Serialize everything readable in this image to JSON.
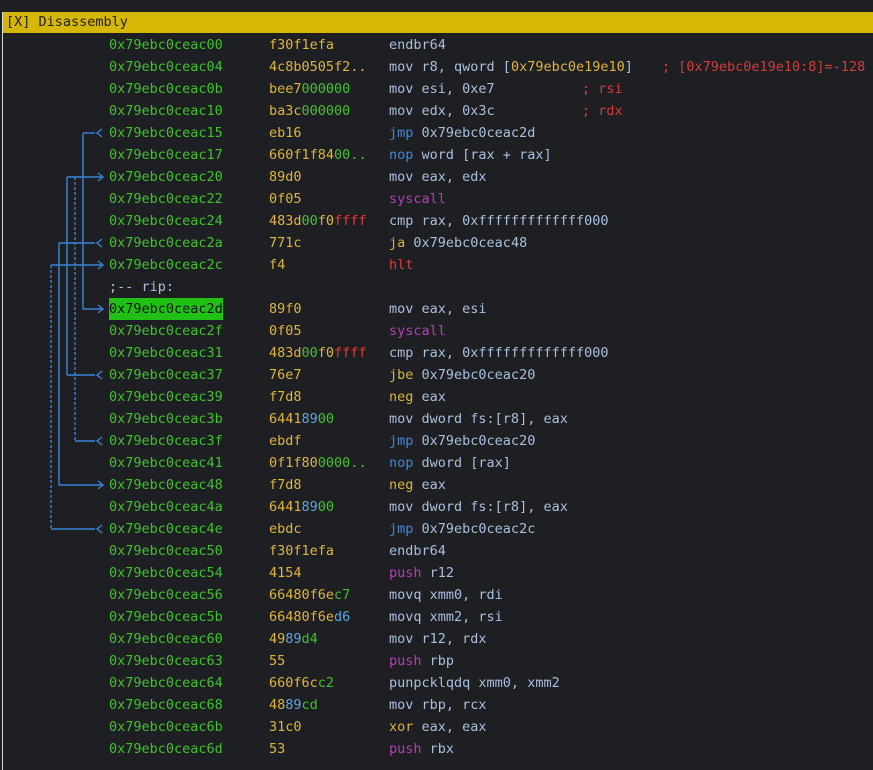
{
  "panel": {
    "title": "[X] Disassembly"
  },
  "rows": [
    {
      "addr": "0x79ebc0ceac00",
      "bytes": [
        [
          "f30f1efa",
          "y"
        ]
      ],
      "mnemonic": "endbr64",
      "mn_class": "plain",
      "operands": [],
      "comment": ""
    },
    {
      "addr": "0x79ebc0ceac04",
      "bytes": [
        [
          "4c8b0505f2..",
          "y"
        ]
      ],
      "mnemonic": "mov",
      "mn_class": "plain",
      "operands": [
        [
          "r8, qword [",
          ""
        ],
        [
          "0x79ebc0e19e10",
          "num"
        ],
        [
          "]",
          ""
        ]
      ],
      "comment": "; [0x79ebc0e19e10:8]=-128"
    },
    {
      "addr": "0x79ebc0ceac0b",
      "bytes": [
        [
          "bee7",
          "y"
        ],
        [
          "000000",
          "g"
        ]
      ],
      "mnemonic": "mov",
      "mn_class": "plain",
      "operands": [
        [
          "esi, 0xe7",
          ""
        ]
      ],
      "comment": "; rsi"
    },
    {
      "addr": "0x79ebc0ceac10",
      "bytes": [
        [
          "ba3c",
          "y"
        ],
        [
          "000000",
          "g"
        ]
      ],
      "mnemonic": "mov",
      "mn_class": "plain",
      "operands": [
        [
          "edx, 0x3c",
          ""
        ]
      ],
      "comment": "; rdx"
    },
    {
      "addr": "0x79ebc0ceac15",
      "bytes": [
        [
          "eb16",
          "y"
        ]
      ],
      "mnemonic": "jmp",
      "mn_class": "blue",
      "operands": [
        [
          "0x79ebc0ceac2d",
          ""
        ]
      ],
      "comment": ""
    },
    {
      "addr": "0x79ebc0ceac17",
      "bytes": [
        [
          "660f1f84",
          "y"
        ],
        [
          "00..",
          "g"
        ]
      ],
      "mnemonic": "nop",
      "mn_class": "blue",
      "operands": [
        [
          "word [rax + rax]",
          ""
        ]
      ],
      "comment": ""
    },
    {
      "addr": "0x79ebc0ceac20",
      "bytes": [
        [
          "89d0",
          "y"
        ]
      ],
      "mnemonic": "mov",
      "mn_class": "plain",
      "operands": [
        [
          "eax, edx",
          ""
        ]
      ],
      "comment": ""
    },
    {
      "addr": "0x79ebc0ceac22",
      "bytes": [
        [
          "0f05",
          "y"
        ]
      ],
      "mnemonic": "syscall",
      "mn_class": "purple",
      "operands": [],
      "comment": ""
    },
    {
      "addr": "0x79ebc0ceac24",
      "bytes": [
        [
          "483d",
          "y"
        ],
        [
          "00",
          "g"
        ],
        [
          "f0",
          "y"
        ],
        [
          "ffff",
          "r"
        ]
      ],
      "mnemonic": "cmp",
      "mn_class": "plain",
      "operands": [
        [
          "rax, 0xfffffffffffff000",
          ""
        ]
      ],
      "comment": ""
    },
    {
      "addr": "0x79ebc0ceac2a",
      "bytes": [
        [
          "771c",
          "y"
        ]
      ],
      "mnemonic": "ja",
      "mn_class": "yellow",
      "operands": [
        [
          "0x79ebc0ceac48",
          ""
        ]
      ],
      "comment": ""
    },
    {
      "addr": "0x79ebc0ceac2c",
      "bytes": [
        [
          "f4",
          "y"
        ]
      ],
      "mnemonic": "hlt",
      "mn_class": "red",
      "operands": [],
      "comment": ""
    },
    {
      "label": ";-- rip:"
    },
    {
      "addr": "0x79ebc0ceac2d",
      "current": true,
      "bytes": [
        [
          "89f0",
          "y"
        ]
      ],
      "mnemonic": "mov",
      "mn_class": "plain",
      "operands": [
        [
          "eax, esi",
          ""
        ]
      ],
      "comment": ""
    },
    {
      "addr": "0x79ebc0ceac2f",
      "bytes": [
        [
          "0f05",
          "y"
        ]
      ],
      "mnemonic": "syscall",
      "mn_class": "purple",
      "operands": [],
      "comment": ""
    },
    {
      "addr": "0x79ebc0ceac31",
      "bytes": [
        [
          "483d",
          "y"
        ],
        [
          "00",
          "g"
        ],
        [
          "f0",
          "y"
        ],
        [
          "ffff",
          "r"
        ]
      ],
      "mnemonic": "cmp",
      "mn_class": "plain",
      "operands": [
        [
          "rax, 0xfffffffffffff000",
          ""
        ]
      ],
      "comment": ""
    },
    {
      "addr": "0x79ebc0ceac37",
      "bytes": [
        [
          "76e7",
          "y"
        ]
      ],
      "mnemonic": "jbe",
      "mn_class": "yellow",
      "operands": [
        [
          "0x79ebc0ceac20",
          ""
        ]
      ],
      "comment": ""
    },
    {
      "addr": "0x79ebc0ceac39",
      "bytes": [
        [
          "f7d8",
          "y"
        ]
      ],
      "mnemonic": "neg",
      "mn_class": "yellow",
      "operands": [
        [
          "eax",
          ""
        ]
      ],
      "comment": ""
    },
    {
      "addr": "0x79ebc0ceac3b",
      "bytes": [
        [
          "6441",
          "y"
        ],
        [
          "89",
          "c"
        ],
        [
          "00",
          "g"
        ]
      ],
      "mnemonic": "mov",
      "mn_class": "plain",
      "operands": [
        [
          "dword fs:[r8], eax",
          ""
        ]
      ],
      "comment": ""
    },
    {
      "addr": "0x79ebc0ceac3f",
      "bytes": [
        [
          "ebdf",
          "y"
        ]
      ],
      "mnemonic": "jmp",
      "mn_class": "blue",
      "operands": [
        [
          "0x79ebc0ceac20",
          ""
        ]
      ],
      "comment": ""
    },
    {
      "addr": "0x79ebc0ceac41",
      "bytes": [
        [
          "0f1f80",
          "y"
        ],
        [
          "0000..",
          "g"
        ]
      ],
      "mnemonic": "nop",
      "mn_class": "blue",
      "operands": [
        [
          "dword [rax]",
          ""
        ]
      ],
      "comment": ""
    },
    {
      "addr": "0x79ebc0ceac48",
      "bytes": [
        [
          "f7d8",
          "y"
        ]
      ],
      "mnemonic": "neg",
      "mn_class": "yellow",
      "operands": [
        [
          "eax",
          ""
        ]
      ],
      "comment": ""
    },
    {
      "addr": "0x79ebc0ceac4a",
      "bytes": [
        [
          "6441",
          "y"
        ],
        [
          "89",
          "c"
        ],
        [
          "00",
          "g"
        ]
      ],
      "mnemonic": "mov",
      "mn_class": "plain",
      "operands": [
        [
          "dword fs:[r8], eax",
          ""
        ]
      ],
      "comment": ""
    },
    {
      "addr": "0x79ebc0ceac4e",
      "bytes": [
        [
          "ebdc",
          "y"
        ]
      ],
      "mnemonic": "jmp",
      "mn_class": "blue",
      "operands": [
        [
          "0x79ebc0ceac2c",
          ""
        ]
      ],
      "comment": ""
    },
    {
      "addr": "0x79ebc0ceac50",
      "bytes": [
        [
          "f30f1efa",
          "y"
        ]
      ],
      "mnemonic": "endbr64",
      "mn_class": "plain",
      "operands": [],
      "comment": ""
    },
    {
      "addr": "0x79ebc0ceac54",
      "bytes": [
        [
          "4154",
          "y"
        ]
      ],
      "mnemonic": "push",
      "mn_class": "purple",
      "operands": [
        [
          "r12",
          ""
        ]
      ],
      "comment": ""
    },
    {
      "addr": "0x79ebc0ceac56",
      "bytes": [
        [
          "66480f6e",
          "y"
        ],
        [
          "c7",
          "g"
        ]
      ],
      "mnemonic": "movq",
      "mn_class": "plain",
      "operands": [
        [
          "xmm0, rdi",
          ""
        ]
      ],
      "comment": ""
    },
    {
      "addr": "0x79ebc0ceac5b",
      "bytes": [
        [
          "66480f6e",
          "y"
        ],
        [
          "d6",
          "c"
        ]
      ],
      "mnemonic": "movq",
      "mn_class": "plain",
      "operands": [
        [
          "xmm2, rsi",
          ""
        ]
      ],
      "comment": ""
    },
    {
      "addr": "0x79ebc0ceac60",
      "bytes": [
        [
          "49",
          "y"
        ],
        [
          "89",
          "c"
        ],
        [
          "d4",
          "g"
        ]
      ],
      "mnemonic": "mov",
      "mn_class": "plain",
      "operands": [
        [
          "r12, rdx",
          ""
        ]
      ],
      "comment": ""
    },
    {
      "addr": "0x79ebc0ceac63",
      "bytes": [
        [
          "55",
          "y"
        ]
      ],
      "mnemonic": "push",
      "mn_class": "purple",
      "operands": [
        [
          "rbp",
          ""
        ]
      ],
      "comment": ""
    },
    {
      "addr": "0x79ebc0ceac64",
      "bytes": [
        [
          "660f6c",
          "y"
        ],
        [
          "c2",
          "g"
        ]
      ],
      "mnemonic": "punpcklqdq",
      "mn_class": "plain",
      "operands": [
        [
          "xmm0, xmm2",
          ""
        ]
      ],
      "comment": ""
    },
    {
      "addr": "0x79ebc0ceac68",
      "bytes": [
        [
          "48",
          "y"
        ],
        [
          "89",
          "c"
        ],
        [
          "cd",
          "g"
        ]
      ],
      "mnemonic": "mov",
      "mn_class": "plain",
      "operands": [
        [
          "rbp, rcx",
          ""
        ]
      ],
      "comment": ""
    },
    {
      "addr": "0x79ebc0ceac6b",
      "bytes": [
        [
          "31c0",
          "y"
        ]
      ],
      "mnemonic": "xor",
      "mn_class": "yellow",
      "operands": [
        [
          "eax, eax",
          ""
        ]
      ],
      "comment": ""
    },
    {
      "addr": "0x79ebc0ceac6d",
      "bytes": [
        [
          "53",
          "y"
        ]
      ],
      "mnemonic": "push",
      "mn_class": "purple",
      "operands": [
        [
          "rbx",
          ""
        ]
      ],
      "comment": ""
    }
  ],
  "colors": {
    "background": "#1e1f22",
    "title_bar": "#d7b706",
    "address": "#43c12d",
    "current_address_bg": "#1fc114",
    "graph_lines": "#3c82d8"
  }
}
